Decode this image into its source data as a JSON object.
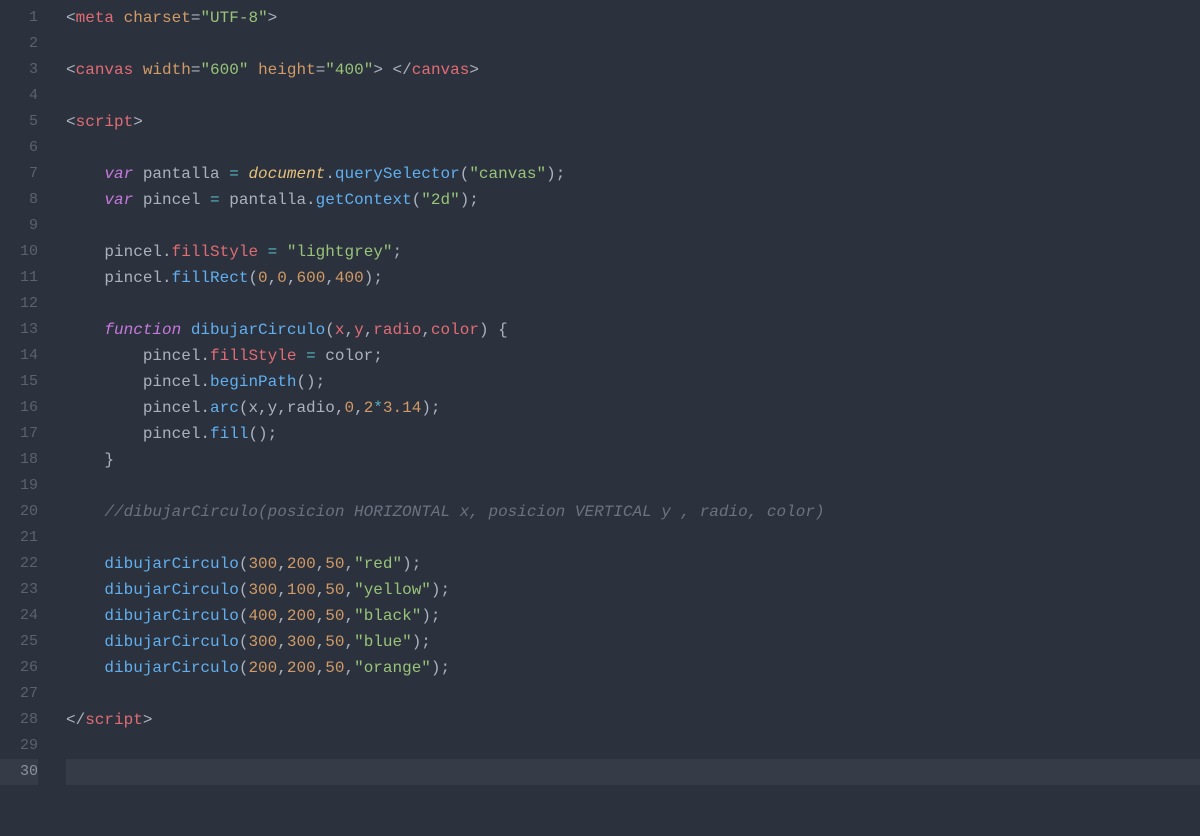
{
  "editor": {
    "line_count": 30,
    "active_line": 30,
    "lines": {
      "1": [
        {
          "cls": "br",
          "t": "<"
        },
        {
          "cls": "t",
          "t": "meta"
        },
        {
          "cls": "p",
          "t": " "
        },
        {
          "cls": "a",
          "t": "charset"
        },
        {
          "cls": "p",
          "t": "="
        },
        {
          "cls": "s",
          "t": "\"UTF-8\""
        },
        {
          "cls": "br",
          "t": ">"
        }
      ],
      "2": [],
      "3": [
        {
          "cls": "br",
          "t": "<"
        },
        {
          "cls": "t",
          "t": "canvas"
        },
        {
          "cls": "p",
          "t": " "
        },
        {
          "cls": "a",
          "t": "width"
        },
        {
          "cls": "p",
          "t": "="
        },
        {
          "cls": "s",
          "t": "\"600\""
        },
        {
          "cls": "p",
          "t": " "
        },
        {
          "cls": "a",
          "t": "height"
        },
        {
          "cls": "p",
          "t": "="
        },
        {
          "cls": "s",
          "t": "\"400\""
        },
        {
          "cls": "br",
          "t": ">"
        },
        {
          "cls": "p",
          "t": " "
        },
        {
          "cls": "br",
          "t": "</"
        },
        {
          "cls": "t",
          "t": "canvas"
        },
        {
          "cls": "br",
          "t": ">"
        }
      ],
      "4": [],
      "5": [
        {
          "cls": "br",
          "t": "<"
        },
        {
          "cls": "t",
          "t": "script"
        },
        {
          "cls": "br",
          "t": ">"
        }
      ],
      "6": [],
      "7": [
        {
          "cls": "p",
          "t": "    "
        },
        {
          "cls": "k",
          "t": "var"
        },
        {
          "cls": "p",
          "t": " pantalla "
        },
        {
          "cls": "o",
          "t": "="
        },
        {
          "cls": "p",
          "t": " "
        },
        {
          "cls": "d",
          "t": "document"
        },
        {
          "cls": "p",
          "t": "."
        },
        {
          "cls": "f",
          "t": "querySelector"
        },
        {
          "cls": "p",
          "t": "("
        },
        {
          "cls": "s",
          "t": "\"canvas\""
        },
        {
          "cls": "p",
          "t": ");"
        }
      ],
      "8": [
        {
          "cls": "p",
          "t": "    "
        },
        {
          "cls": "k",
          "t": "var"
        },
        {
          "cls": "p",
          "t": " pincel "
        },
        {
          "cls": "o",
          "t": "="
        },
        {
          "cls": "p",
          "t": " pantalla."
        },
        {
          "cls": "f",
          "t": "getContext"
        },
        {
          "cls": "p",
          "t": "("
        },
        {
          "cls": "s",
          "t": "\"2d\""
        },
        {
          "cls": "p",
          "t": ");"
        }
      ],
      "9": [],
      "10": [
        {
          "cls": "p",
          "t": "    pincel."
        },
        {
          "cls": "pr",
          "t": "fillStyle"
        },
        {
          "cls": "p",
          "t": " "
        },
        {
          "cls": "o",
          "t": "="
        },
        {
          "cls": "p",
          "t": " "
        },
        {
          "cls": "s",
          "t": "\"lightgrey\""
        },
        {
          "cls": "p",
          "t": ";"
        }
      ],
      "11": [
        {
          "cls": "p",
          "t": "    pincel."
        },
        {
          "cls": "f",
          "t": "fillRect"
        },
        {
          "cls": "p",
          "t": "("
        },
        {
          "cls": "n",
          "t": "0"
        },
        {
          "cls": "p",
          "t": ","
        },
        {
          "cls": "n",
          "t": "0"
        },
        {
          "cls": "p",
          "t": ","
        },
        {
          "cls": "n",
          "t": "600"
        },
        {
          "cls": "p",
          "t": ","
        },
        {
          "cls": "n",
          "t": "400"
        },
        {
          "cls": "p",
          "t": ");"
        }
      ],
      "12": [],
      "13": [
        {
          "cls": "p",
          "t": "    "
        },
        {
          "cls": "k",
          "t": "function"
        },
        {
          "cls": "p",
          "t": " "
        },
        {
          "cls": "fn",
          "t": "dibujarCirculo"
        },
        {
          "cls": "p",
          "t": "("
        },
        {
          "cls": "pr",
          "t": "x"
        },
        {
          "cls": "p",
          "t": ","
        },
        {
          "cls": "pr",
          "t": "y"
        },
        {
          "cls": "p",
          "t": ","
        },
        {
          "cls": "pr",
          "t": "radio"
        },
        {
          "cls": "p",
          "t": ","
        },
        {
          "cls": "pr",
          "t": "color"
        },
        {
          "cls": "p",
          "t": ") {"
        }
      ],
      "14": [
        {
          "cls": "p",
          "t": "        pincel."
        },
        {
          "cls": "pr",
          "t": "fillStyle"
        },
        {
          "cls": "p",
          "t": " "
        },
        {
          "cls": "o",
          "t": "="
        },
        {
          "cls": "p",
          "t": " color;"
        }
      ],
      "15": [
        {
          "cls": "p",
          "t": "        pincel."
        },
        {
          "cls": "f",
          "t": "beginPath"
        },
        {
          "cls": "p",
          "t": "();"
        }
      ],
      "16": [
        {
          "cls": "p",
          "t": "        pincel."
        },
        {
          "cls": "f",
          "t": "arc"
        },
        {
          "cls": "p",
          "t": "(x,y,radio,"
        },
        {
          "cls": "n",
          "t": "0"
        },
        {
          "cls": "p",
          "t": ","
        },
        {
          "cls": "n",
          "t": "2"
        },
        {
          "cls": "o",
          "t": "*"
        },
        {
          "cls": "n",
          "t": "3.14"
        },
        {
          "cls": "p",
          "t": ");"
        }
      ],
      "17": [
        {
          "cls": "p",
          "t": "        pincel."
        },
        {
          "cls": "f",
          "t": "fill"
        },
        {
          "cls": "p",
          "t": "();"
        }
      ],
      "18": [
        {
          "cls": "p",
          "t": "    }"
        }
      ],
      "19": [],
      "20": [
        {
          "cls": "p",
          "t": "    "
        },
        {
          "cls": "c",
          "t": "//dibujarCirculo(posicion HORIZONTAL x, posicion VERTICAL y , radio, color)"
        }
      ],
      "21": [],
      "22": [
        {
          "cls": "p",
          "t": "    "
        },
        {
          "cls": "f",
          "t": "dibujarCirculo"
        },
        {
          "cls": "p",
          "t": "("
        },
        {
          "cls": "n",
          "t": "300"
        },
        {
          "cls": "p",
          "t": ","
        },
        {
          "cls": "n",
          "t": "200"
        },
        {
          "cls": "p",
          "t": ","
        },
        {
          "cls": "n",
          "t": "50"
        },
        {
          "cls": "p",
          "t": ","
        },
        {
          "cls": "s",
          "t": "\"red\""
        },
        {
          "cls": "p",
          "t": ");"
        }
      ],
      "23": [
        {
          "cls": "p",
          "t": "    "
        },
        {
          "cls": "f",
          "t": "dibujarCirculo"
        },
        {
          "cls": "p",
          "t": "("
        },
        {
          "cls": "n",
          "t": "300"
        },
        {
          "cls": "p",
          "t": ","
        },
        {
          "cls": "n",
          "t": "100"
        },
        {
          "cls": "p",
          "t": ","
        },
        {
          "cls": "n",
          "t": "50"
        },
        {
          "cls": "p",
          "t": ","
        },
        {
          "cls": "s",
          "t": "\"yellow\""
        },
        {
          "cls": "p",
          "t": ");"
        }
      ],
      "24": [
        {
          "cls": "p",
          "t": "    "
        },
        {
          "cls": "f",
          "t": "dibujarCirculo"
        },
        {
          "cls": "p",
          "t": "("
        },
        {
          "cls": "n",
          "t": "400"
        },
        {
          "cls": "p",
          "t": ","
        },
        {
          "cls": "n",
          "t": "200"
        },
        {
          "cls": "p",
          "t": ","
        },
        {
          "cls": "n",
          "t": "50"
        },
        {
          "cls": "p",
          "t": ","
        },
        {
          "cls": "s",
          "t": "\"black\""
        },
        {
          "cls": "p",
          "t": ");"
        }
      ],
      "25": [
        {
          "cls": "p",
          "t": "    "
        },
        {
          "cls": "f",
          "t": "dibujarCirculo"
        },
        {
          "cls": "p",
          "t": "("
        },
        {
          "cls": "n",
          "t": "300"
        },
        {
          "cls": "p",
          "t": ","
        },
        {
          "cls": "n",
          "t": "300"
        },
        {
          "cls": "p",
          "t": ","
        },
        {
          "cls": "n",
          "t": "50"
        },
        {
          "cls": "p",
          "t": ","
        },
        {
          "cls": "s",
          "t": "\"blue\""
        },
        {
          "cls": "p",
          "t": ");"
        }
      ],
      "26": [
        {
          "cls": "p",
          "t": "    "
        },
        {
          "cls": "f",
          "t": "dibujarCirculo"
        },
        {
          "cls": "p",
          "t": "("
        },
        {
          "cls": "n",
          "t": "200"
        },
        {
          "cls": "p",
          "t": ","
        },
        {
          "cls": "n",
          "t": "200"
        },
        {
          "cls": "p",
          "t": ","
        },
        {
          "cls": "n",
          "t": "50"
        },
        {
          "cls": "p",
          "t": ","
        },
        {
          "cls": "s",
          "t": "\"orange\""
        },
        {
          "cls": "p",
          "t": ");"
        }
      ],
      "27": [],
      "28": [
        {
          "cls": "br",
          "t": "</"
        },
        {
          "cls": "t",
          "t": "script"
        },
        {
          "cls": "br",
          "t": ">"
        }
      ],
      "29": [],
      "30": []
    }
  }
}
